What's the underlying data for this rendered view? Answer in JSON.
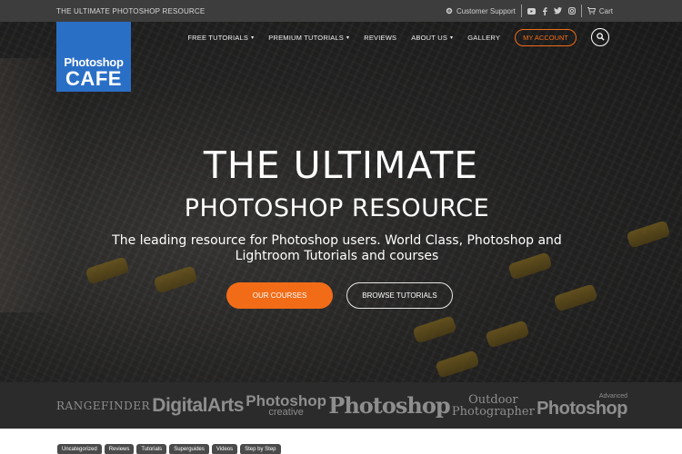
{
  "topbar": {
    "tagline": "THE ULTIMATE PHOTOSHOP RESOURCE",
    "support_label": "Customer Support",
    "cart_label": "Cart"
  },
  "logo": {
    "line1": "Photoshop",
    "line2": "CAFE"
  },
  "nav": {
    "items": [
      {
        "label": "FREE TUTORIALS",
        "dropdown": true
      },
      {
        "label": "PREMIUM TUTORIALS",
        "dropdown": true
      },
      {
        "label": "REVIEWS",
        "dropdown": false
      },
      {
        "label": "ABOUT US",
        "dropdown": true
      },
      {
        "label": "GALLERY",
        "dropdown": false
      }
    ],
    "account_label": "MY ACCOUNT"
  },
  "hero": {
    "title": "THE ULTIMATE",
    "subtitle": "PHOTOSHOP RESOURCE",
    "description_line1": "The leading resource for Photoshop users. World Class, Photoshop and",
    "description_line2": "Lightroom Tutorials and courses",
    "primary_button": "OUR COURSES",
    "secondary_button": "BROWSE TUTORIALS"
  },
  "partners": {
    "rangefinder": "RANGEFINDER",
    "digitalarts": "DigitalArts",
    "creative_a": "Photoshop",
    "creative_b": "creative",
    "photoshop": "Photoshop",
    "outdoor_a": "Outdoor",
    "outdoor_b": "Photographer",
    "advanced_a": "Advanced",
    "advanced_b": "Photoshop"
  },
  "tags": [
    "Uncategorized",
    "Reviews",
    "Tutorials",
    "Superguides",
    "Videos",
    "Step by Step"
  ],
  "colors": {
    "accent": "#f26c18",
    "logo_blue": "#2a6fc6",
    "topbar": "#3d3d3d"
  }
}
